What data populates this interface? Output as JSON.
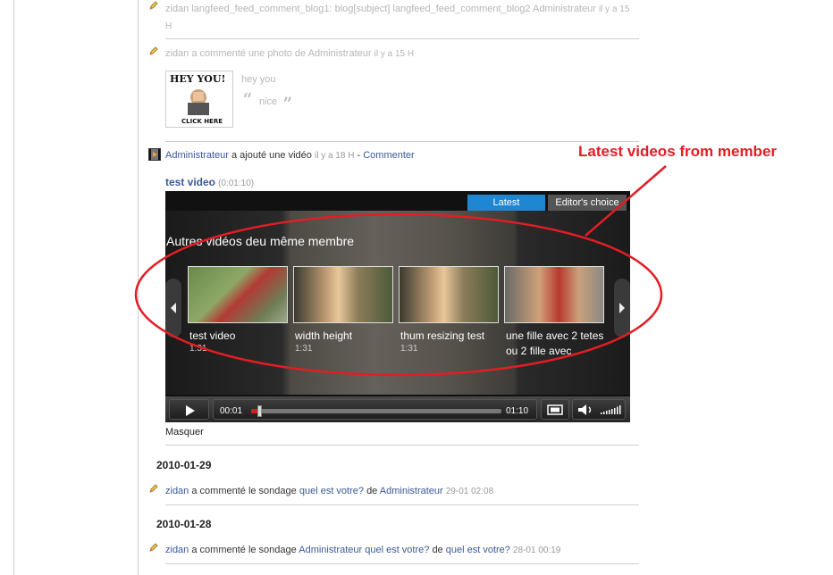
{
  "feed_items": [
    {
      "user": "zidan",
      "text": "langfeed_feed_comment_blog1: blog[subject] langfeed_feed_comment_blog2 Administrateur",
      "time": "il y a 15 H"
    },
    {
      "user": "zidan",
      "text": "a commenté une photo de Administrateur",
      "time": "il y a 15 H",
      "photo_text": [
        "HEY YOU!",
        "CLICK HERE"
      ],
      "caption": "hey you",
      "quote": "nice",
      "open_quote": "“",
      "close_quote": "”"
    },
    {
      "user": "Administrateur",
      "text": "a ajouté une vidéo",
      "time": "il y a 18 H",
      "separator": "-",
      "comment_link": "Commenter",
      "video_title": "test video",
      "video_duration": "(0:01:10)",
      "hide_link": "Masquer"
    }
  ],
  "player": {
    "tabs": [
      "Latest",
      "Editor's choice"
    ],
    "overlay_title": "Autres vidéos deu même membre",
    "videos": [
      {
        "title": "test video",
        "duration": "1:31"
      },
      {
        "title": "width height",
        "duration": "1:31"
      },
      {
        "title": "thum resizing test",
        "duration": "1:31"
      },
      {
        "title": "une fille avec 2 tetes ou 2 fille avec",
        "duration": ""
      }
    ],
    "current_time": "00:01",
    "total_time": "01:10",
    "progress": 0.03
  },
  "dated_sections": [
    {
      "date": "2010-01-29",
      "user": "zidan",
      "action": "a commenté le sondage",
      "poll": "quel est votre?",
      "de": "de",
      "target": "Administrateur",
      "time": "29-01 02:08"
    },
    {
      "date": "2010-01-28",
      "user": "zidan",
      "action": "a commenté le sondage",
      "poll_owner": "Administrateur",
      "poll": "quel est votre?",
      "de": "de",
      "target": "quel est votre?",
      "time": "28-01 00:19"
    }
  ],
  "annotation": "Latest videos from member",
  "colors": {
    "annotation": "#e21d24",
    "link": "#3b5998",
    "tab_active": "#1f86d2",
    "progress": "#cc2222"
  }
}
